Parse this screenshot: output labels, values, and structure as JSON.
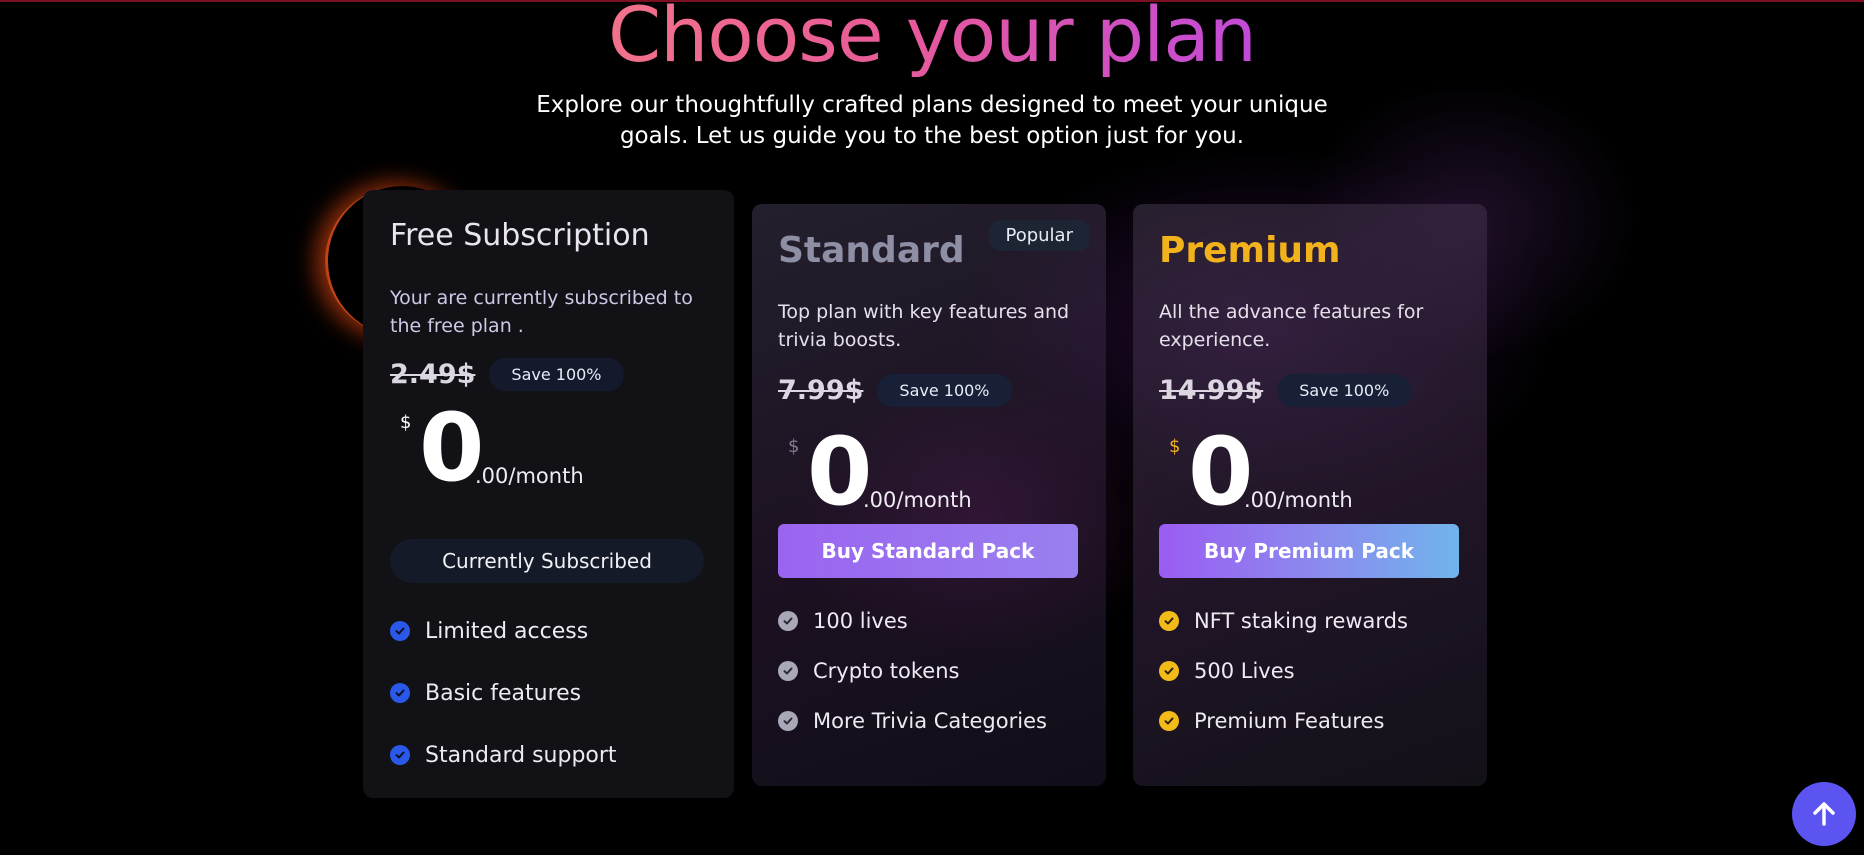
{
  "header": {
    "title": "Choose your plan",
    "subtitle_line1": "Explore our thoughtfully crafted plans designed to meet your unique",
    "subtitle_line2": "goals. Let us guide you to the best option just for you."
  },
  "plans": [
    {
      "name": "Free Subscription",
      "description": "Your are currently subscribed to the free plan .",
      "old_price": "2.49$",
      "save_label": "Save 100%",
      "currency": "$",
      "amount": "0",
      "suffix": ".00/month",
      "button_label": "Currently Subscribed",
      "features": [
        "Limited access",
        "Basic features",
        "Standard support"
      ],
      "check_color": "#2a58e8"
    },
    {
      "name": "Standard",
      "badge": "Popular",
      "description": "Top plan with key features and trivia boosts.",
      "old_price": "7.99$",
      "save_label": "Save 100%",
      "currency": "$",
      "amount": "0",
      "suffix": ".00/month",
      "button_label": "Buy Standard Pack",
      "features": [
        "100 lives",
        "Crypto tokens",
        "More Trivia Categories"
      ],
      "check_color": "#a8a8b8"
    },
    {
      "name": "Premium",
      "description": "All the advance features for experience.",
      "old_price": "14.99$",
      "save_label": "Save 100%",
      "currency": "$",
      "amount": "0",
      "suffix": ".00/month",
      "button_label": "Buy Premium Pack",
      "features": [
        "NFT staking rewards",
        "500 Lives",
        "Premium Features"
      ],
      "check_color": "#f2bb1a"
    }
  ],
  "colors": {
    "title_gradient_start": "#f2728a",
    "title_gradient_end": "#c24ad8",
    "premium_accent": "#f2b21c",
    "button_purple": "#9b64f0",
    "scroll_top_bg": "#5b54f0"
  },
  "icons": {
    "check": "check-circle-icon",
    "scroll_top": "arrow-up-icon"
  }
}
